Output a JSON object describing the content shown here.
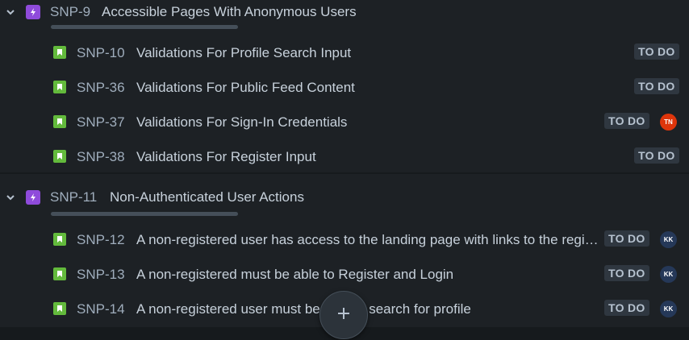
{
  "colors": {
    "background": "#1d2125",
    "epic_icon": "#8f4bdb",
    "story_icon": "#63ba3c",
    "status_bg": "#2f3740",
    "avatar_tn": "#de350b",
    "avatar_kk": "#253858"
  },
  "epics": [
    {
      "key": "SNP-9",
      "title": "Accessible Pages With Anonymous Users",
      "icon": "chevron-down-icon",
      "issues": [
        {
          "key": "SNP-10",
          "title": "Validations For Profile Search Input",
          "status": "TO DO",
          "assignee": ""
        },
        {
          "key": "SNP-36",
          "title": "Validations For Public Feed Content",
          "status": "TO DO",
          "assignee": ""
        },
        {
          "key": "SNP-37",
          "title": "Validations For Sign-In Credentials",
          "status": "TO DO",
          "assignee": "TN"
        },
        {
          "key": "SNP-38",
          "title": "Validations For Register Input",
          "status": "TO DO",
          "assignee": ""
        }
      ]
    },
    {
      "key": "SNP-11",
      "title": "Non-Authenticated User Actions",
      "icon": "chevron-down-icon",
      "issues": [
        {
          "key": "SNP-12",
          "title": "A non-registered user has access to the landing page with links to the registration page",
          "status": "TO DO",
          "assignee": "KK"
        },
        {
          "key": "SNP-13",
          "title": "A non-registered must be able to Register and Login",
          "status": "TO DO",
          "assignee": "KK"
        },
        {
          "key": "SNP-14",
          "title": "A non-registered user must be able to search for profile",
          "status": "TO DO",
          "assignee": "KK"
        }
      ]
    }
  ],
  "fab": {
    "icon": "plus-icon"
  }
}
